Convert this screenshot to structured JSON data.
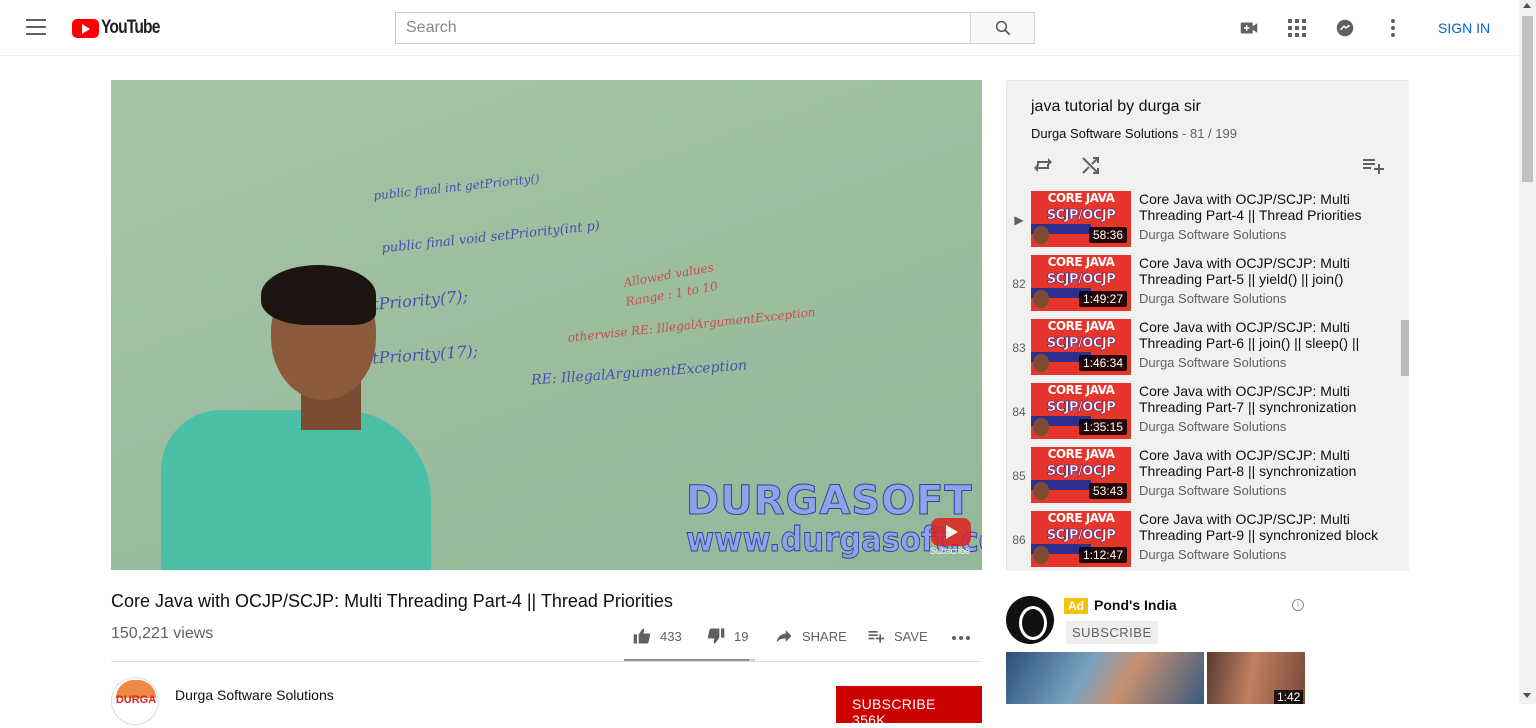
{
  "header": {
    "logo_text": "YouTube",
    "search_placeholder": "Search",
    "signin": "SIGN IN"
  },
  "player": {
    "watermark_line1": "DURGASOFT",
    "watermark_line2": "www.durgasoft.com",
    "subscribe_overlay": "Subscribe",
    "board_lines": [
      "public final int getPriority()",
      "public final void setPriority(int p)",
      "t.setPriority(7);",
      "t.setPriority(17);",
      "Allowed values",
      "Range : 1 to 10",
      "otherwise RE: IllegalArgumentException",
      "RE: IllegalArgumentException"
    ]
  },
  "video": {
    "title": "Core Java with OCJP/SCJP: Multi Threading Part-4 || Thread Priorities",
    "views": "150,221 views",
    "likes": "433",
    "dislikes": "19",
    "like_ratio": 0.958,
    "share": "SHARE",
    "save": "SAVE",
    "channel": "Durga Software Solutions",
    "channel_avatar_text": "DURGA",
    "subscribe": "SUBSCRIBE 356K"
  },
  "playlist": {
    "title": "java tutorial by durga sir",
    "owner": "Durga Software Solutions",
    "position": " - 81 / 199",
    "items": [
      {
        "index": "▶",
        "title": "Core Java with OCJP/SCJP: Multi Threading Part-4 || Thread Priorities",
        "channel": "Durga Software Solutions",
        "duration": "58:36"
      },
      {
        "index": "82",
        "title": "Core Java with OCJP/SCJP: Multi Threading Part-5 || yield() || join()",
        "channel": "Durga Software Solutions",
        "duration": "1:49:27"
      },
      {
        "index": "83",
        "title": "Core Java with OCJP/SCJP: Multi Threading Part-6 || join() || sleep() ||",
        "channel": "Durga Software Solutions",
        "duration": "1:46:34"
      },
      {
        "index": "84",
        "title": "Core Java with OCJP/SCJP: Multi Threading Part-7 || synchronization",
        "channel": "Durga Software Solutions",
        "duration": "1:35:15"
      },
      {
        "index": "85",
        "title": "Core Java with OCJP/SCJP: Multi Threading Part-8 || synchronization",
        "channel": "Durga Software Solutions",
        "duration": "53:43"
      },
      {
        "index": "86",
        "title": "Core Java with OCJP/SCJP: Multi Threading Part-9 || synchronized block",
        "channel": "Durga Software Solutions",
        "duration": "1:12:47"
      }
    ],
    "thumb_top": "CORE JAVA",
    "thumb_main": "SCJP/OCJP"
  },
  "ad": {
    "badge": "Ad",
    "name": "Pond's India",
    "subscribe": "SUBSCRIBE",
    "duration": "1:42"
  },
  "colors": {
    "brand_red": "#ff0000",
    "subscribe_red": "#cc0000",
    "link_blue": "#065fd4",
    "ad_yellow": "#f4c20d"
  },
  "icons": [
    "menu-icon",
    "search-icon",
    "video-camera-icon",
    "apps-grid-icon",
    "messages-icon",
    "more-vert-icon",
    "loop-icon",
    "shuffle-icon",
    "playlist-add-icon",
    "thumb-up-icon",
    "thumb-down-icon",
    "share-icon",
    "save-icon",
    "more-horiz-icon",
    "info-icon"
  ]
}
